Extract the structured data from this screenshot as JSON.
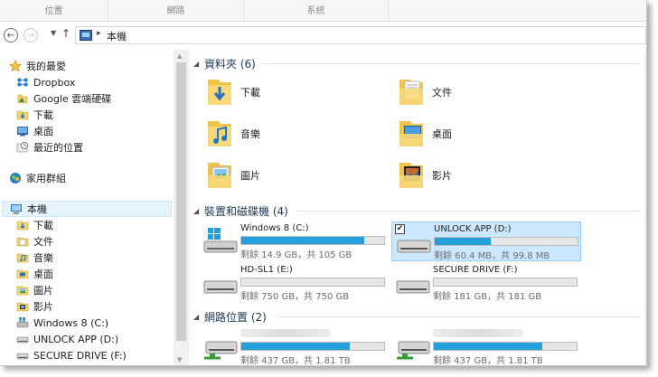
{
  "ribbon": {
    "tabs": [
      "位置",
      "網路",
      "系統"
    ]
  },
  "address": {
    "separator": "▸",
    "path": "本機"
  },
  "nav": {
    "favorites_label": "我的最愛",
    "favorites": [
      "Dropbox",
      "Google 雲端硬碟",
      "下載",
      "桌面",
      "最近的位置"
    ],
    "homegroup_label": "家用群組",
    "thispc_label": "本機",
    "thispc_items": [
      "下載",
      "文件",
      "音樂",
      "桌面",
      "圖片",
      "影片",
      "Windows 8 (C:)",
      "UNLOCK APP (D:)",
      "SECURE DRIVE (F:)"
    ]
  },
  "content": {
    "folders_header": "資料夾 (6)",
    "folders": [
      "下載",
      "文件",
      "音樂",
      "桌面",
      "圖片",
      "影片"
    ],
    "devices_header": "裝置和磁碟機 (4)",
    "drives": [
      {
        "name": "Windows 8 (C:)",
        "status": "剩餘 14.9 GB，共 105 GB",
        "used_fraction": 0.86
      },
      {
        "name": "UNLOCK APP (D:)",
        "status": "剩餘 60.4 MB，共 99.8 MB",
        "used_fraction": 0.39
      },
      {
        "name": "HD-SL1 (E:)",
        "status": "剩餘 750 GB，共 750 GB",
        "used_fraction": 0.0
      },
      {
        "name": "SECURE DRIVE (F:)",
        "status": "剩餘 181 GB，共 181 GB",
        "used_fraction": 0.0
      }
    ],
    "network_header": "網路位置 (2)",
    "network": [
      {
        "status": "剩餘 437 GB，共 1.81 TB",
        "used_fraction": 0.76
      },
      {
        "status": "剩餘 437 GB，共 1.81 TB",
        "used_fraction": 0.76
      }
    ]
  },
  "colors": {
    "accent_bar": "#26a0da",
    "selection": "#cce8ff",
    "header_text": "#1e395b"
  }
}
